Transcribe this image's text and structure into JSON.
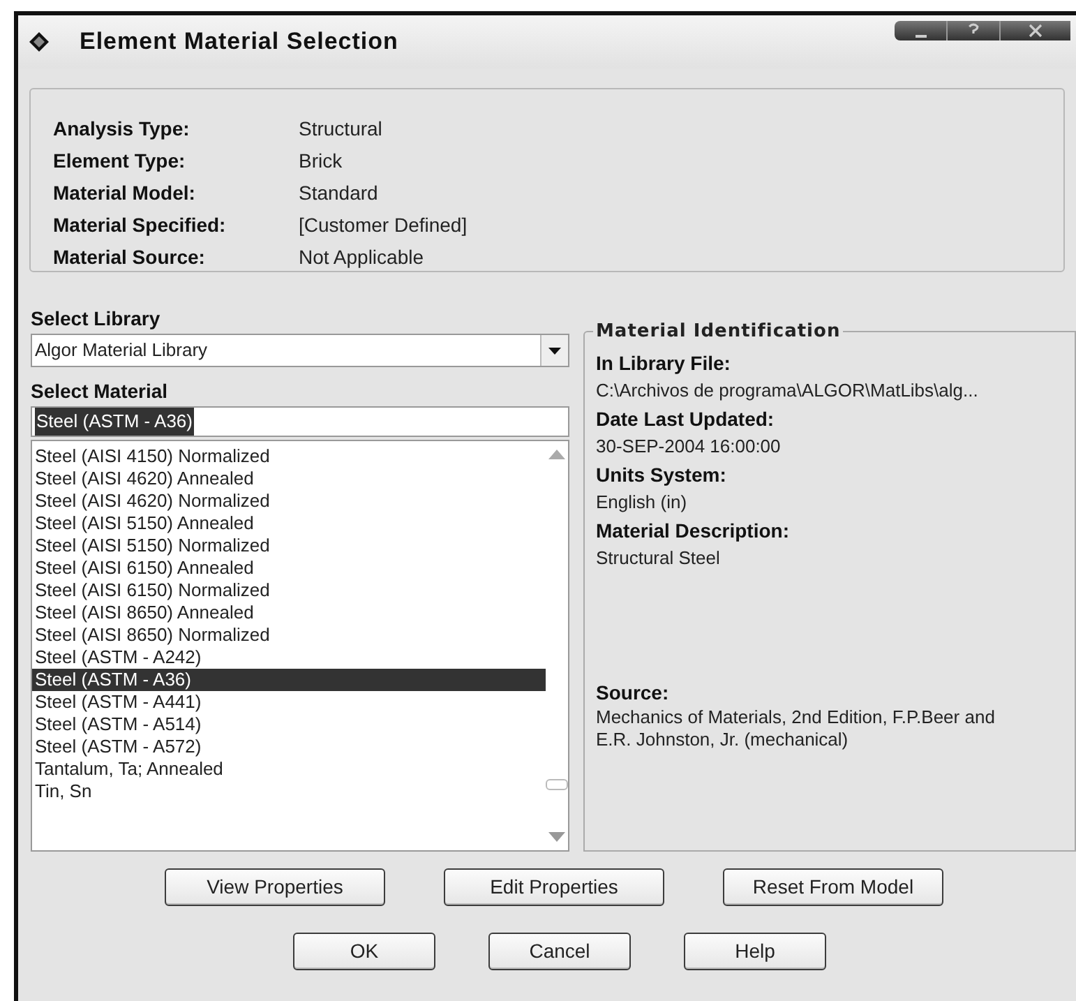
{
  "window": {
    "title": "Element Material Selection"
  },
  "info": [
    {
      "label": "Analysis Type:",
      "value": "Structural"
    },
    {
      "label": "Element Type:",
      "value": "Brick"
    },
    {
      "label": "Material Model:",
      "value": "Standard"
    },
    {
      "label": "Material Specified:",
      "value": "[Customer Defined]"
    },
    {
      "label": "Material Source:",
      "value": "Not Applicable"
    }
  ],
  "library": {
    "label": "Select Library",
    "value": "Algor Material Library"
  },
  "material": {
    "label": "Select Material",
    "value": "Steel (ASTM - A36)"
  },
  "materials": [
    {
      "name": "Steel (AISI 4150) Normalized",
      "selected": false
    },
    {
      "name": "Steel (AISI 4620) Annealed",
      "selected": false
    },
    {
      "name": "Steel (AISI 4620) Normalized",
      "selected": false
    },
    {
      "name": "Steel (AISI 5150) Annealed",
      "selected": false
    },
    {
      "name": "Steel (AISI 5150) Normalized",
      "selected": false
    },
    {
      "name": "Steel (AISI 6150) Annealed",
      "selected": false
    },
    {
      "name": "Steel (AISI 6150) Normalized",
      "selected": false
    },
    {
      "name": "Steel (AISI 8650) Annealed",
      "selected": false
    },
    {
      "name": "Steel (AISI 8650) Normalized",
      "selected": false
    },
    {
      "name": "Steel (ASTM - A242)",
      "selected": false
    },
    {
      "name": "Steel (ASTM - A36)",
      "selected": true
    },
    {
      "name": "Steel (ASTM - A441)",
      "selected": false
    },
    {
      "name": "Steel (ASTM - A514)",
      "selected": false
    },
    {
      "name": "Steel (ASTM - A572)",
      "selected": false
    },
    {
      "name": "Tantalum, Ta; Annealed",
      "selected": false
    },
    {
      "name": "Tin, Sn",
      "selected": false
    }
  ],
  "identification": {
    "title": "Material Identification",
    "fields": [
      {
        "label": "In Library File:",
        "value": "C:\\Archivos de programa\\ALGOR\\MatLibs\\alg..."
      },
      {
        "label": "Date Last Updated:",
        "value": "30-SEP-2004 16:00:00"
      },
      {
        "label": "Units System:",
        "value": "English (in)"
      },
      {
        "label": "Material Description:",
        "value": "Structural Steel"
      }
    ],
    "source": {
      "label": "Source:",
      "value": "Mechanics of Materials, 2nd Edition, F.P.Beer and E.R. Johnston, Jr. (mechanical)"
    }
  },
  "property_buttons": [
    "View Properties",
    "Edit Properties",
    "Reset From Model"
  ],
  "dialog_buttons": [
    "OK",
    "Cancel",
    "Help"
  ]
}
